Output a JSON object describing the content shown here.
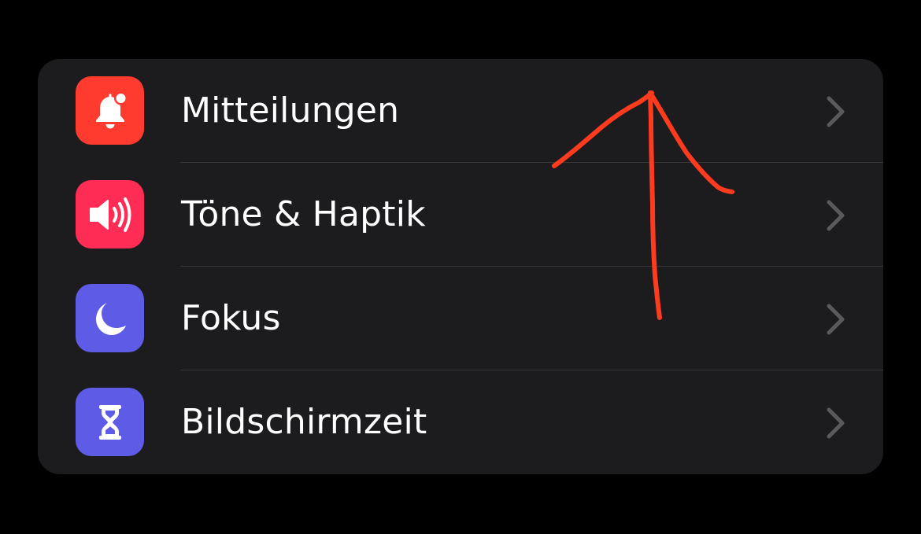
{
  "settings": {
    "items": [
      {
        "label": "Mitteilungen",
        "icon": "bell-icon",
        "color": "#ff3b30"
      },
      {
        "label": "Töne & Haptik",
        "icon": "speaker-icon",
        "color": "#ff2d55"
      },
      {
        "label": "Fokus",
        "icon": "moon-icon",
        "color": "#5e5ce6"
      },
      {
        "label": "Bildschirmzeit",
        "icon": "hourglass-icon",
        "color": "#5e5ce6"
      }
    ]
  },
  "colors": {
    "background": "#000000",
    "group_background": "#1c1c1e",
    "separator": "#38383a",
    "chevron": "#5a5a5e",
    "annotation_arrow": "#ff3b1f"
  }
}
